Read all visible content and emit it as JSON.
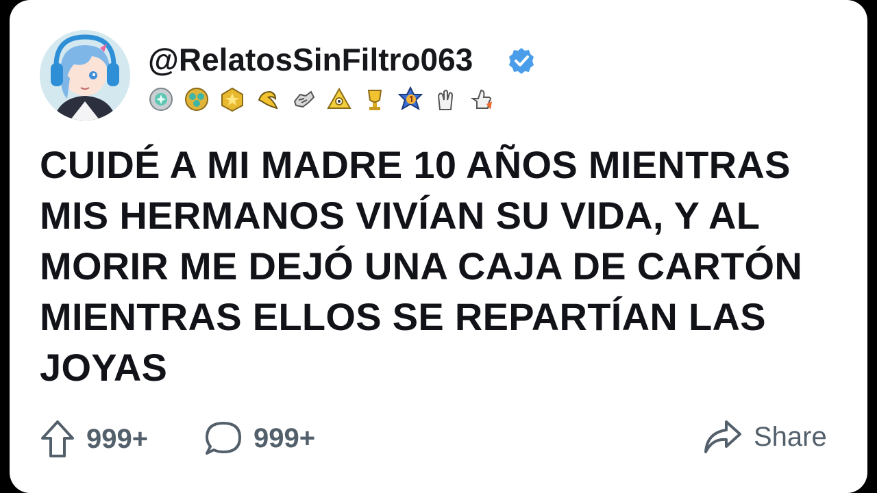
{
  "post": {
    "username": "@RelatosSinFiltro063",
    "title": "CUIDÉ A MI MADRE 10 AÑOS MIENTRAS MIS HERMANOS VIVÍAN SU VIDA, Y AL MORIR ME DEJÓ UNA CAJA DE CARTÓN MIENTRAS ELLOS SE REPARTÍAN LAS JOYAS",
    "verified_color": "#4a9de8"
  },
  "badges": [
    "award-badge-1",
    "award-badge-2",
    "award-badge-3",
    "award-badge-4",
    "award-badge-5",
    "award-badge-6",
    "award-badge-7",
    "award-badge-8",
    "award-badge-9",
    "award-badge-10"
  ],
  "actions": {
    "upvote_count": "999+",
    "comment_count": "999+",
    "share_label": "Share"
  },
  "colors": {
    "background": "#000000",
    "card": "#ffffff",
    "text": "#111318",
    "muted": "#53606b"
  }
}
